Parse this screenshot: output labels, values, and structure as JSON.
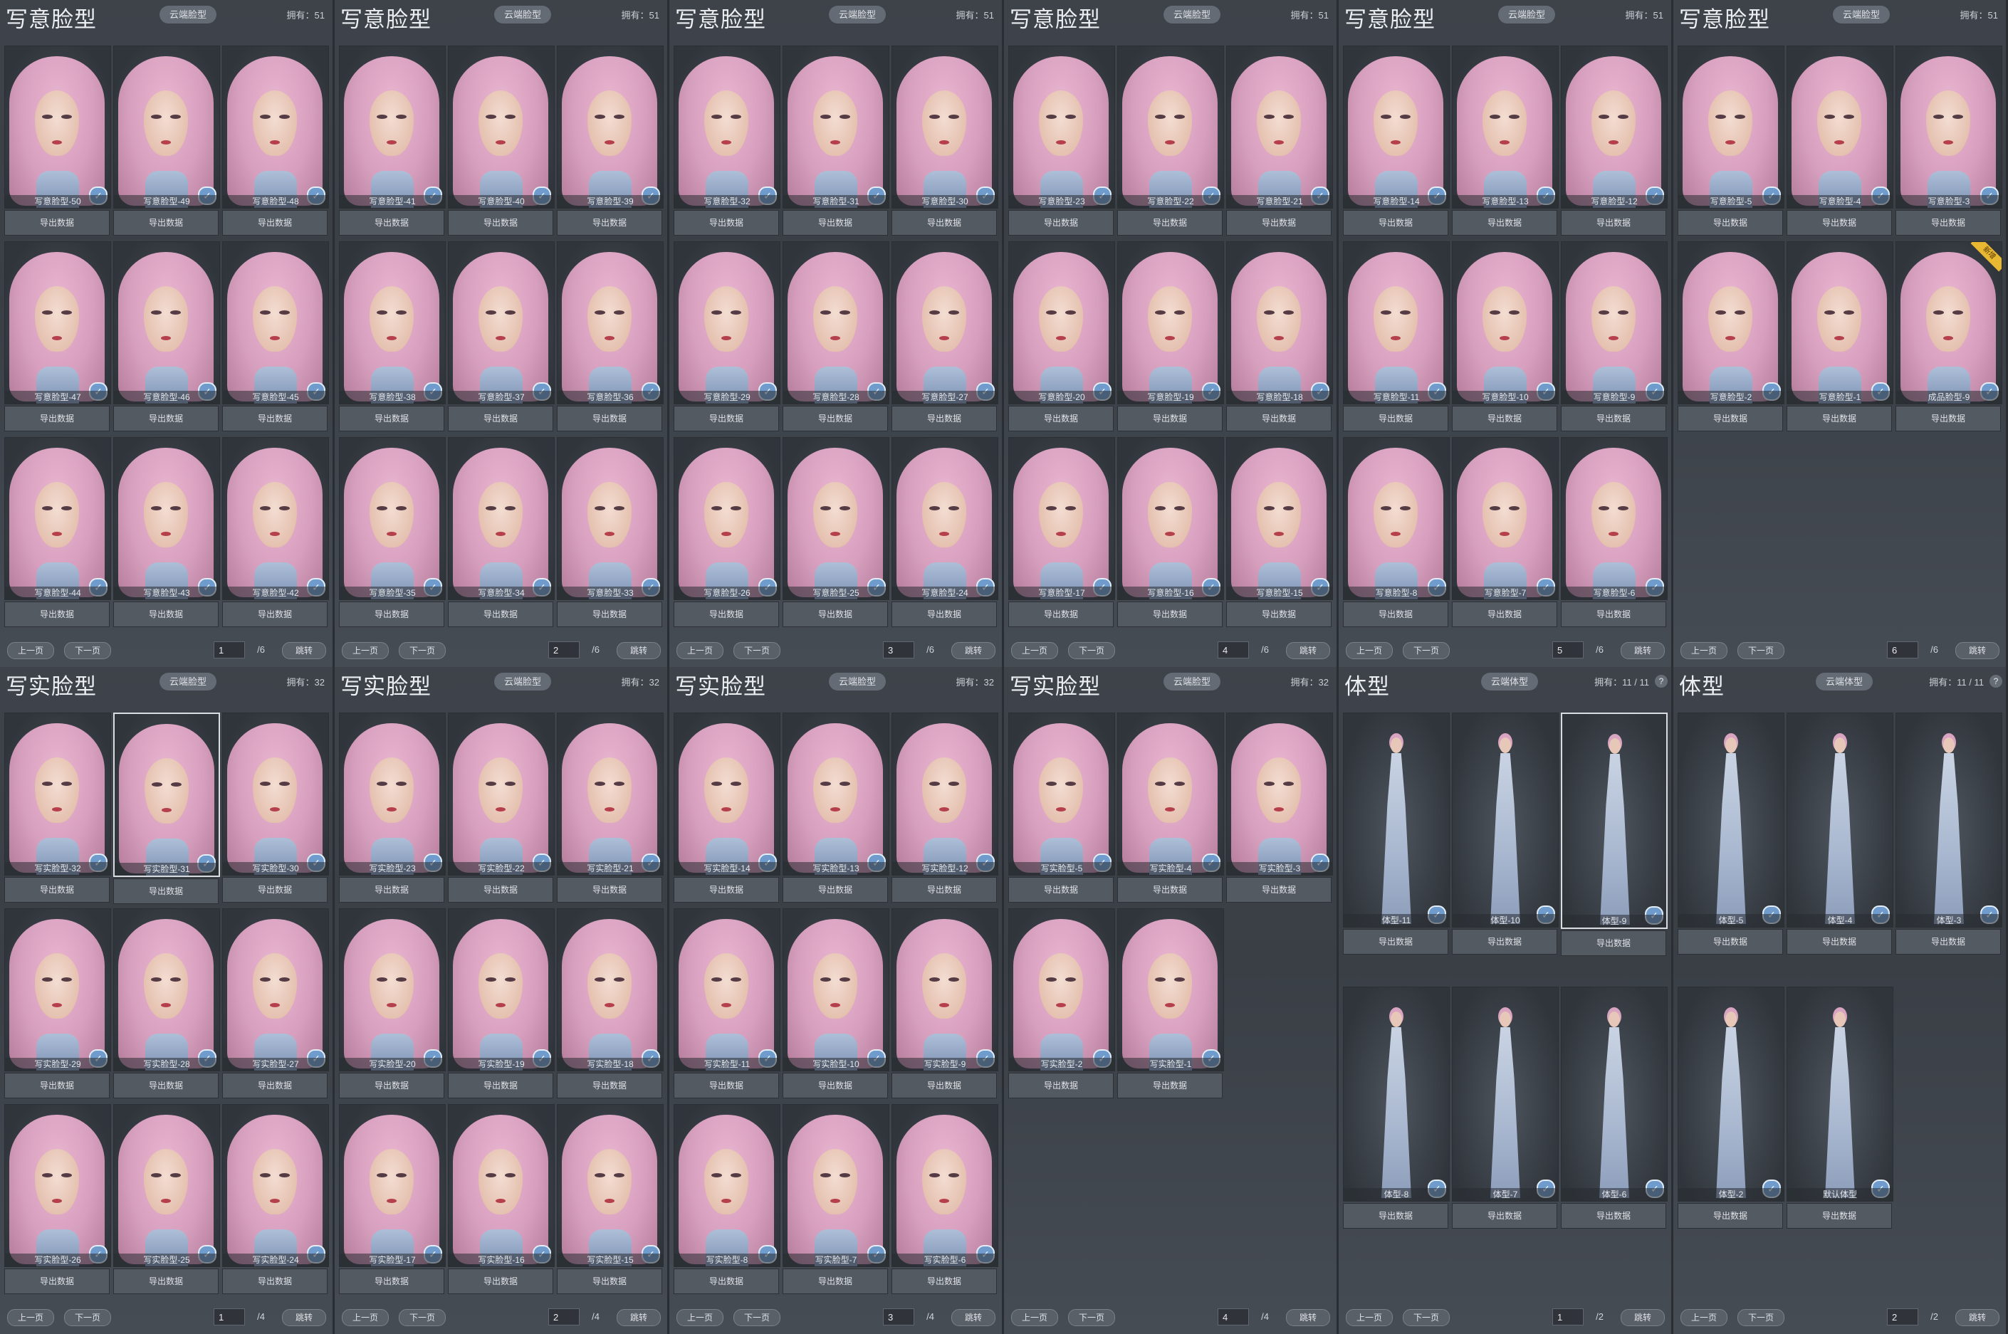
{
  "common": {
    "export_label": "导出数据",
    "prev_label": "上一页",
    "next_label": "下一页",
    "jump_label": "跳转",
    "owned_prefix": "拥有：",
    "check_icon": "check-badge-icon",
    "new_badge": "新增"
  },
  "panels": [
    {
      "title": "写意脸型",
      "cloud_label": "云端脸型",
      "owned": "51",
      "kind": "face",
      "page": "1",
      "total": "/6",
      "items": [
        {
          "label": "写意脸型-50"
        },
        {
          "label": "写意脸型-49"
        },
        {
          "label": "写意脸型-48"
        },
        {
          "label": "写意脸型-47"
        },
        {
          "label": "写意脸型-46"
        },
        {
          "label": "写意脸型-45"
        },
        {
          "label": "写意脸型-44"
        },
        {
          "label": "写意脸型-43"
        },
        {
          "label": "写意脸型-42"
        }
      ]
    },
    {
      "title": "写意脸型",
      "cloud_label": "云端脸型",
      "owned": "51",
      "kind": "face",
      "page": "2",
      "total": "/6",
      "items": [
        {
          "label": "写意脸型-41"
        },
        {
          "label": "写意脸型-40"
        },
        {
          "label": "写意脸型-39"
        },
        {
          "label": "写意脸型-38"
        },
        {
          "label": "写意脸型-37"
        },
        {
          "label": "写意脸型-36"
        },
        {
          "label": "写意脸型-35"
        },
        {
          "label": "写意脸型-34"
        },
        {
          "label": "写意脸型-33"
        }
      ]
    },
    {
      "title": "写意脸型",
      "cloud_label": "云端脸型",
      "owned": "51",
      "kind": "face",
      "page": "3",
      "total": "/6",
      "items": [
        {
          "label": "写意脸型-32"
        },
        {
          "label": "写意脸型-31"
        },
        {
          "label": "写意脸型-30"
        },
        {
          "label": "写意脸型-29"
        },
        {
          "label": "写意脸型-28"
        },
        {
          "label": "写意脸型-27"
        },
        {
          "label": "写意脸型-26"
        },
        {
          "label": "写意脸型-25"
        },
        {
          "label": "写意脸型-24"
        }
      ]
    },
    {
      "title": "写意脸型",
      "cloud_label": "云端脸型",
      "owned": "51",
      "kind": "face",
      "page": "4",
      "total": "/6",
      "items": [
        {
          "label": "写意脸型-23"
        },
        {
          "label": "写意脸型-22"
        },
        {
          "label": "写意脸型-21"
        },
        {
          "label": "写意脸型-20"
        },
        {
          "label": "写意脸型-19"
        },
        {
          "label": "写意脸型-18"
        },
        {
          "label": "写意脸型-17"
        },
        {
          "label": "写意脸型-16"
        },
        {
          "label": "写意脸型-15"
        }
      ]
    },
    {
      "title": "写意脸型",
      "cloud_label": "云端脸型",
      "owned": "51",
      "kind": "face",
      "page": "5",
      "total": "/6",
      "items": [
        {
          "label": "写意脸型-14"
        },
        {
          "label": "写意脸型-13"
        },
        {
          "label": "写意脸型-12"
        },
        {
          "label": "写意脸型-11"
        },
        {
          "label": "写意脸型-10"
        },
        {
          "label": "写意脸型-9"
        },
        {
          "label": "写意脸型-8"
        },
        {
          "label": "写意脸型-7"
        },
        {
          "label": "写意脸型-6"
        }
      ]
    },
    {
      "title": "写意脸型",
      "cloud_label": "云端脸型",
      "owned": "51",
      "kind": "face",
      "page": "6",
      "total": "/6",
      "items": [
        {
          "label": "写意脸型-5"
        },
        {
          "label": "写意脸型-4"
        },
        {
          "label": "写意脸型-3"
        },
        {
          "label": "写意脸型-2"
        },
        {
          "label": "写意脸型-1"
        },
        {
          "label": "成品脸型-9",
          "badge": true
        }
      ]
    },
    {
      "title": "写实脸型",
      "cloud_label": "云端脸型",
      "owned": "32",
      "kind": "face",
      "page": "1",
      "total": "/4",
      "items": [
        {
          "label": "写实脸型-32"
        },
        {
          "label": "写实脸型-31",
          "selected": true
        },
        {
          "label": "写实脸型-30"
        },
        {
          "label": "写实脸型-29"
        },
        {
          "label": "写实脸型-28"
        },
        {
          "label": "写实脸型-27"
        },
        {
          "label": "写实脸型-26"
        },
        {
          "label": "写实脸型-25"
        },
        {
          "label": "写实脸型-24"
        }
      ]
    },
    {
      "title": "写实脸型",
      "cloud_label": "云端脸型",
      "owned": "32",
      "kind": "face",
      "page": "2",
      "total": "/4",
      "items": [
        {
          "label": "写实脸型-23"
        },
        {
          "label": "写实脸型-22"
        },
        {
          "label": "写实脸型-21"
        },
        {
          "label": "写实脸型-20"
        },
        {
          "label": "写实脸型-19"
        },
        {
          "label": "写实脸型-18"
        },
        {
          "label": "写实脸型-17"
        },
        {
          "label": "写实脸型-16"
        },
        {
          "label": "写实脸型-15"
        }
      ]
    },
    {
      "title": "写实脸型",
      "cloud_label": "云端脸型",
      "owned": "32",
      "kind": "face",
      "page": "3",
      "total": "/4",
      "items": [
        {
          "label": "写实脸型-14"
        },
        {
          "label": "写实脸型-13"
        },
        {
          "label": "写实脸型-12"
        },
        {
          "label": "写实脸型-11"
        },
        {
          "label": "写实脸型-10"
        },
        {
          "label": "写实脸型-9"
        },
        {
          "label": "写实脸型-8"
        },
        {
          "label": "写实脸型-7"
        },
        {
          "label": "写实脸型-6"
        }
      ]
    },
    {
      "title": "写实脸型",
      "cloud_label": "云端脸型",
      "owned": "32",
      "kind": "face",
      "page": "4",
      "total": "/4",
      "items": [
        {
          "label": "写实脸型-5"
        },
        {
          "label": "写实脸型-4"
        },
        {
          "label": "写实脸型-3"
        },
        {
          "label": "写实脸型-2"
        },
        {
          "label": "写实脸型-1"
        }
      ]
    },
    {
      "title": "体型",
      "cloud_label": "云端体型",
      "owned": "11 / 11",
      "kind": "body",
      "page": "1",
      "total": "/2",
      "help": "?",
      "items": [
        {
          "label": "体型-11"
        },
        {
          "label": "体型-10"
        },
        {
          "label": "体型-9",
          "selected": true
        },
        {
          "label": "体型-8"
        },
        {
          "label": "体型-7"
        },
        {
          "label": "体型-6"
        }
      ]
    },
    {
      "title": "体型",
      "cloud_label": "云端体型",
      "owned": "11 / 11",
      "kind": "body",
      "page": "2",
      "total": "/2",
      "help": "?",
      "items": [
        {
          "label": "体型-5"
        },
        {
          "label": "体型-4"
        },
        {
          "label": "体型-3"
        },
        {
          "label": "体型-2"
        },
        {
          "label": "默认体型"
        }
      ]
    }
  ]
}
